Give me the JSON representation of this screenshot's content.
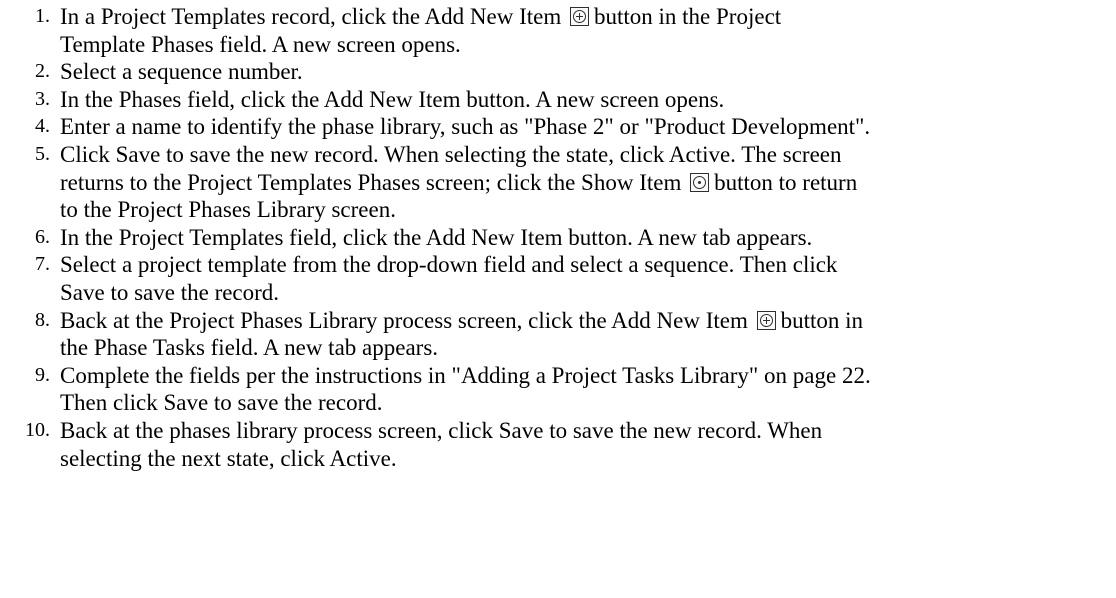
{
  "steps": [
    {
      "num": "1.",
      "lines": [
        {
          "a": "In a Project Templates record, click the Add New Item",
          "b": "button in the Project"
        },
        {
          "a": "Template Phases field. A new screen opens."
        }
      ]
    },
    {
      "num": "2.",
      "lines": [
        {
          "a": "Select a sequence number."
        }
      ]
    },
    {
      "num": "3.",
      "lines": [
        {
          "a": "In the Phases field, click the Add New Item button. A new screen opens."
        }
      ]
    },
    {
      "num": "4.",
      "lines": [
        {
          "a": "Enter a name to identify the phase library, such as \"Phase 2\" or \"Product Development\"."
        }
      ]
    },
    {
      "num": "5.",
      "lines": [
        {
          "a": "Click Save to save the new record. When selecting the state, click Active. The screen"
        },
        {
          "a": "returns to the Project Templates Phases screen; click the Show Item",
          "b": "button to return"
        },
        {
          "a": "to the Project Phases Library screen."
        }
      ]
    },
    {
      "num": "6.",
      "lines": [
        {
          "a": "In the Project Templates field, click the Add New Item button. A new tab appears."
        }
      ]
    },
    {
      "num": "7.",
      "lines": [
        {
          "a": "Select a project template from the drop-down field and select a sequence. Then click"
        },
        {
          "a": "Save to save the record."
        }
      ]
    },
    {
      "num": "8.",
      "lines": [
        {
          "a": "Back at the Project Phases Library process screen, click the Add New Item",
          "b": "button in"
        },
        {
          "a": "the Phase Tasks field. A new tab appears."
        }
      ]
    },
    {
      "num": "9.",
      "lines": [
        {
          "a": "Complete the fields per the instructions in \"Adding a Project Tasks Library\" on page 22."
        },
        {
          "a": "Then click Save to save the record."
        }
      ]
    },
    {
      "num": "10.",
      "lines": [
        {
          "a": "Back at the phases library process screen, click Save to save the new record. When"
        },
        {
          "a": "selecting the next state, click Active."
        }
      ]
    }
  ],
  "icons": {
    "add_new_item": "add-new-item-icon",
    "show_item": "show-item-icon"
  }
}
